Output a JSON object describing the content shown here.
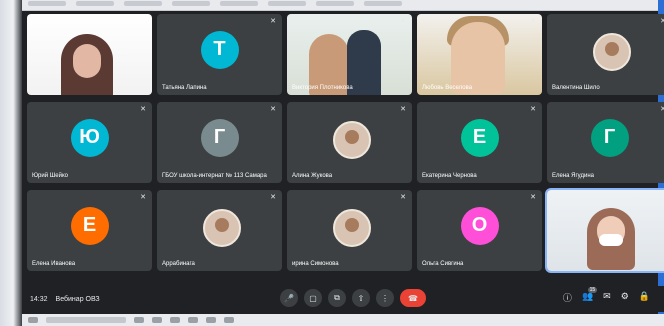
{
  "meeting": {
    "time": "14:32",
    "title": "Вебинар ОВЗ"
  },
  "colors": {
    "teal": "#00b8d4",
    "green": "#00c39a",
    "orange": "#ff6d00",
    "slate": "#7a8b90",
    "pink": "#ff4fd8",
    "end_call": "#ea4335"
  },
  "participants": [
    {
      "name": "",
      "initial": "",
      "avatar": "video-woman"
    },
    {
      "name": "Татьяна Лапина",
      "initial": "Т",
      "avatar": "teal"
    },
    {
      "name": "Виктория Плотникова",
      "initial": "",
      "avatar": "video-pair"
    },
    {
      "name": "Любовь Веселова",
      "initial": "",
      "avatar": "video-woman-yellow"
    },
    {
      "name": "Валентина Шило",
      "initial": "",
      "avatar": "photo"
    },
    {
      "name": "Юрий Шейко",
      "initial": "Ю",
      "avatar": "teal"
    },
    {
      "name": "ГБОУ школа-интернат № 113 Самара",
      "initial": "Г",
      "avatar": "slate"
    },
    {
      "name": "Алина Жукова",
      "initial": "",
      "avatar": "photo"
    },
    {
      "name": "Екатерина Чернова",
      "initial": "Е",
      "avatar": "green"
    },
    {
      "name": "Елена Ягудина",
      "initial": "Г",
      "avatar": "green"
    },
    {
      "name": "Елена Иванова",
      "initial": "Е",
      "avatar": "orange"
    },
    {
      "name": "Аррабинага",
      "initial": "",
      "avatar": "photo"
    },
    {
      "name": "ирина Симонова",
      "initial": "",
      "avatar": "photo"
    },
    {
      "name": "Ольга Сивгина",
      "initial": "О",
      "avatar": "pink"
    },
    {
      "name": "",
      "initial": "",
      "avatar": "video-masked"
    }
  ],
  "controls": {
    "mic_icon": "microphone-icon",
    "camera_icon": "camera-icon",
    "captions_icon": "captions-icon",
    "present_icon": "present-icon",
    "more_icon": "more-options-icon",
    "end_icon": "end-call-icon"
  },
  "people_count": "15"
}
